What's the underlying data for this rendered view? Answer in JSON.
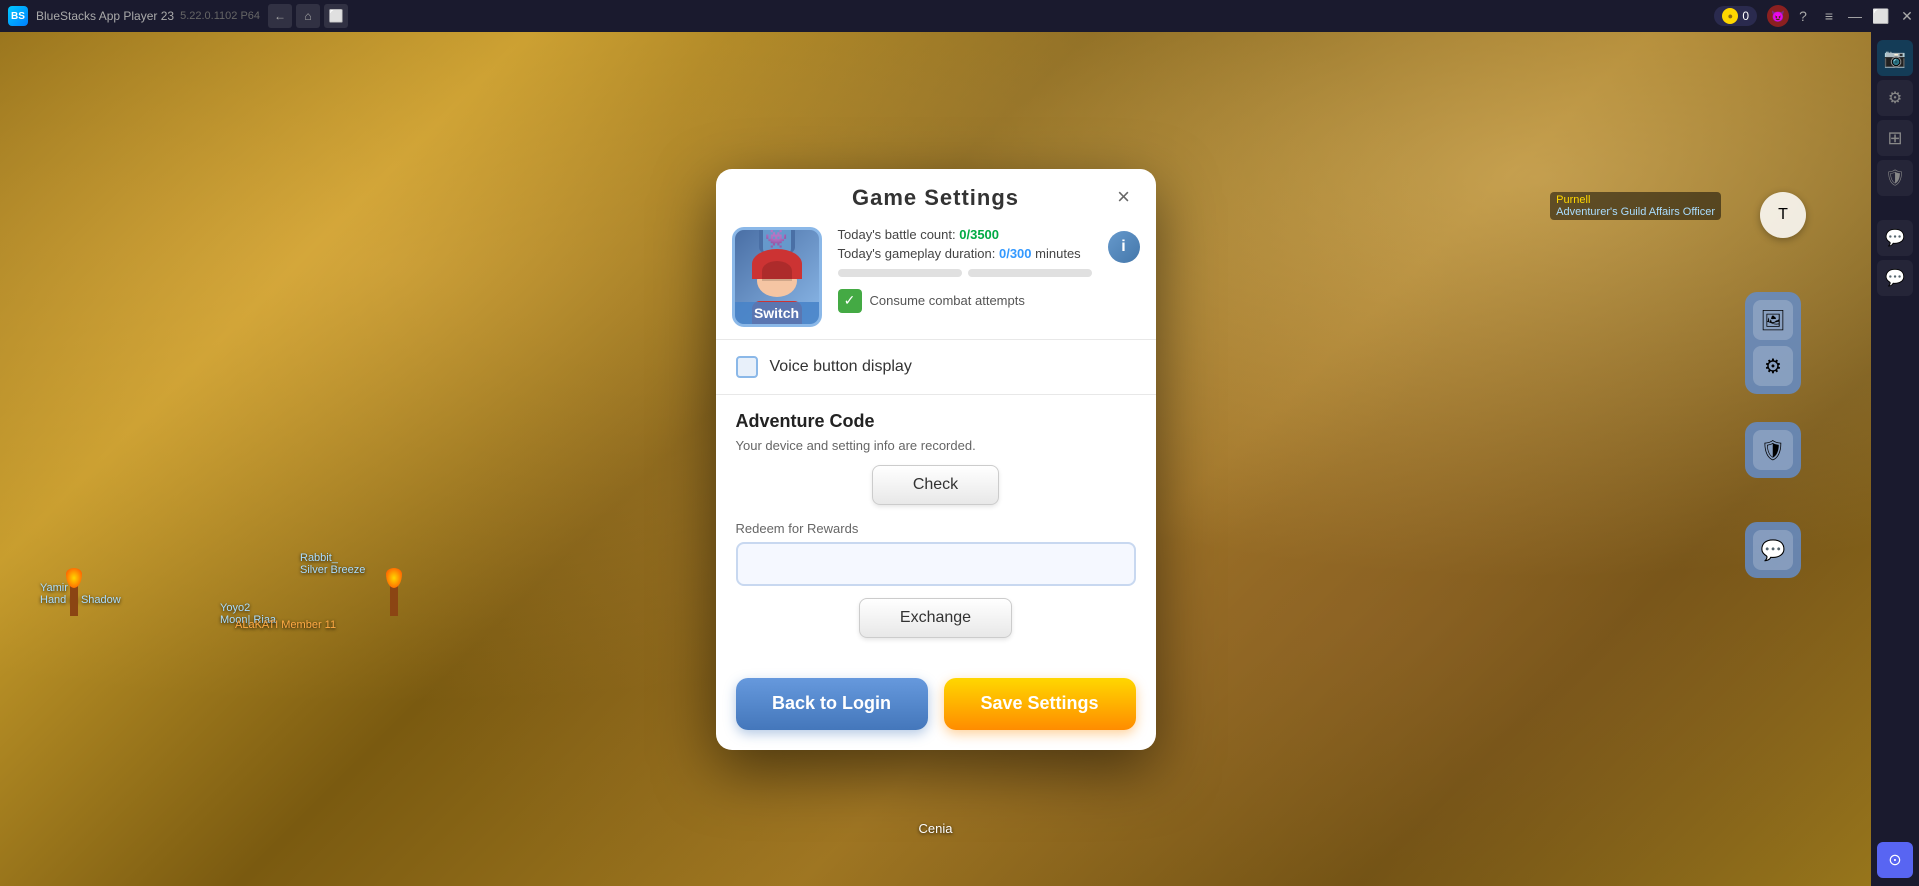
{
  "titlebar": {
    "title": "BlueStacks App Player 23",
    "subtitle": "5.22.0.1102 P64",
    "coin_count": "0"
  },
  "modal": {
    "title": "Game Settings",
    "close_label": "×",
    "switch_label": "Switch",
    "battle_count_label": "Today's battle count:",
    "battle_count_value": "0/3500",
    "gameplay_duration_label": "Today's gameplay duration:",
    "gameplay_duration_value": "0/300",
    "gameplay_duration_unit": "minutes",
    "consume_label": "Consume combat attempts",
    "voice_label": "Voice button display",
    "adventure_title": "Adventure Code",
    "adventure_desc": "Your device and setting info are recorded.",
    "check_label": "Check",
    "redeem_label": "Redeem for Rewards",
    "redeem_placeholder": "",
    "exchange_label": "Exchange",
    "back_label": "Back to Login",
    "save_label": "Save Settings"
  },
  "sidebar": {
    "icons": [
      "⊞",
      "📷",
      "⚙",
      "🛡",
      "💬"
    ]
  },
  "world": {
    "cenia_label": "Cenia",
    "player1_name": "Yamir",
    "player1_title": "Hand in Shadow",
    "player2_name": "Yoyo2",
    "player2_name2": "Moon| Riaa",
    "player3_name": "Rabbit_",
    "player3_title": "Silver Breeze",
    "player4_name": "ALaKATI Member 11",
    "npc_name": "Purnell",
    "npc_title": "Adventurer's Guild Affairs Officer"
  }
}
